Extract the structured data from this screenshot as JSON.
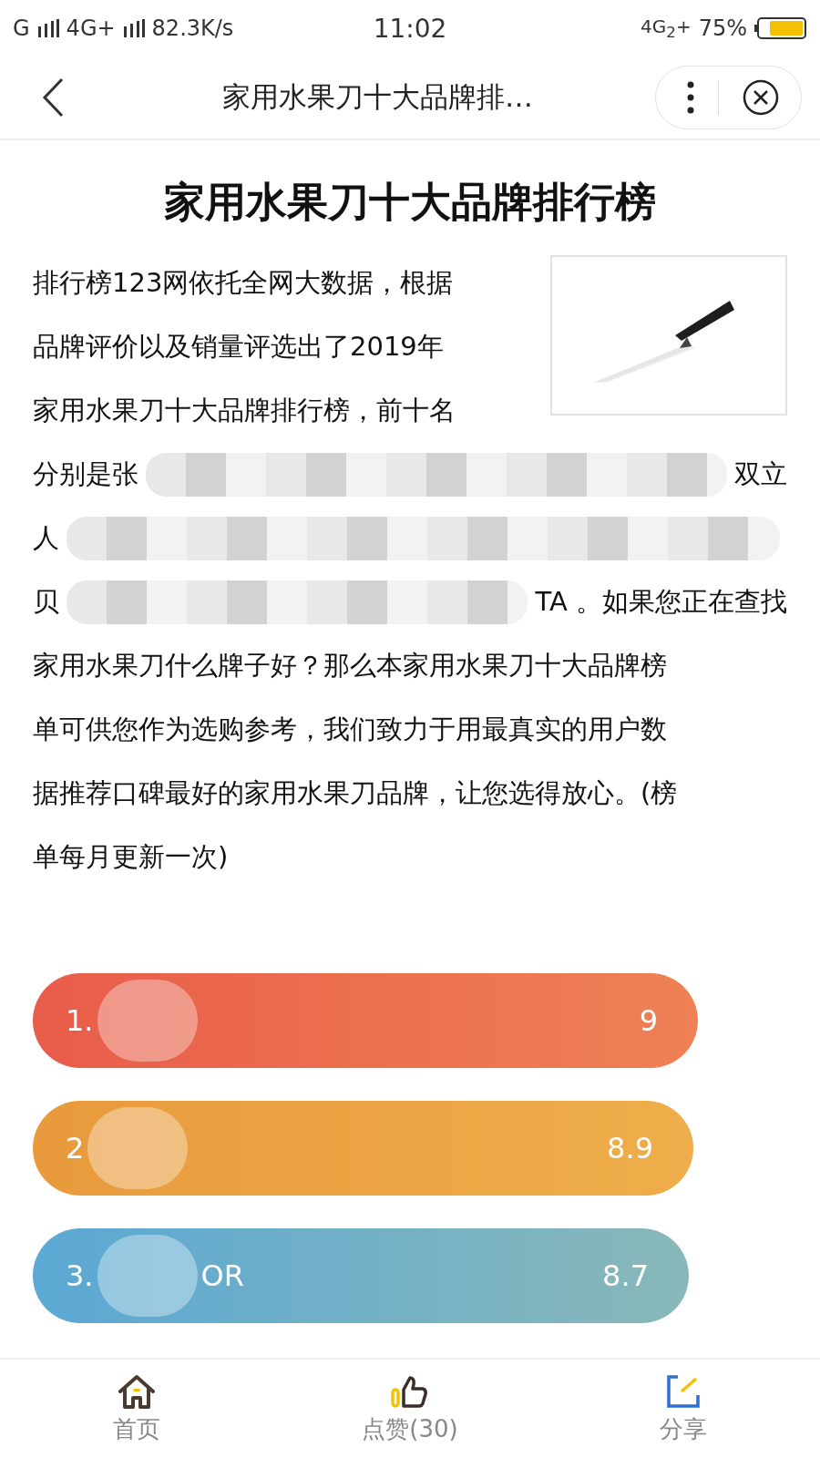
{
  "status_bar": {
    "sim_1": "G",
    "sim_2": "4G+",
    "speed": "82.3K/s",
    "time": "11:02",
    "network": "4G$_{2}$+",
    "battery": "75%"
  },
  "nav_bar": {
    "title": "家用水果刀十大品牌排…"
  },
  "article": {
    "heading": "家用水果刀十大品牌排行榜",
    "lines": [
      {
        "segments": [
          {
            "kind": "text",
            "text": "排行榜123网依托全网大数据，根据"
          }
        ]
      },
      {
        "segments": [
          {
            "kind": "text",
            "text": "品牌评价以及销量评选出了2019年"
          }
        ]
      },
      {
        "segments": [
          {
            "kind": "text",
            "text": "家用水果刀十大品牌排行榜，前十名"
          }
        ]
      },
      {
        "segments": [
          {
            "kind": "text",
            "text": "分别是张"
          },
          {
            "kind": "redacted"
          },
          {
            "kind": "text",
            "text": "双立"
          }
        ]
      },
      {
        "segments": [
          {
            "kind": "text",
            "text": "人"
          },
          {
            "kind": "redacted"
          }
        ]
      },
      {
        "segments": [
          {
            "kind": "text",
            "text": "贝"
          },
          {
            "kind": "redacted"
          },
          {
            "kind": "text",
            "text": "TA 。如果您正在查找"
          }
        ]
      },
      {
        "segments": [
          {
            "kind": "text",
            "text": "家用水果刀什么牌子好？那么本家用水果刀十大品牌榜"
          }
        ]
      },
      {
        "segments": [
          {
            "kind": "text",
            "text": "单可供您作为选购参考，我们致力于用最真实的用户数"
          }
        ]
      },
      {
        "segments": [
          {
            "kind": "text",
            "text": "据推荐口碑最好的家用水果刀品牌，让您选得放心。(榜"
          }
        ]
      },
      {
        "segments": [
          {
            "kind": "text",
            "text": "单每月更新一次)"
          }
        ]
      }
    ]
  },
  "ranking": [
    {
      "rank": "1.",
      "score": "9",
      "color": "#e85c4a"
    },
    {
      "rank": "2",
      "score": "8.9",
      "color": "#e89a3c"
    },
    {
      "rank": "3.",
      "suffix": "OR",
      "score": "8.7",
      "color": "#5aa8d4"
    }
  ],
  "tab_bar": [
    {
      "kind": "home",
      "label": "首页"
    },
    {
      "kind": "like",
      "label": "点赞(30)"
    },
    {
      "kind": "share",
      "label": "分享"
    }
  ]
}
